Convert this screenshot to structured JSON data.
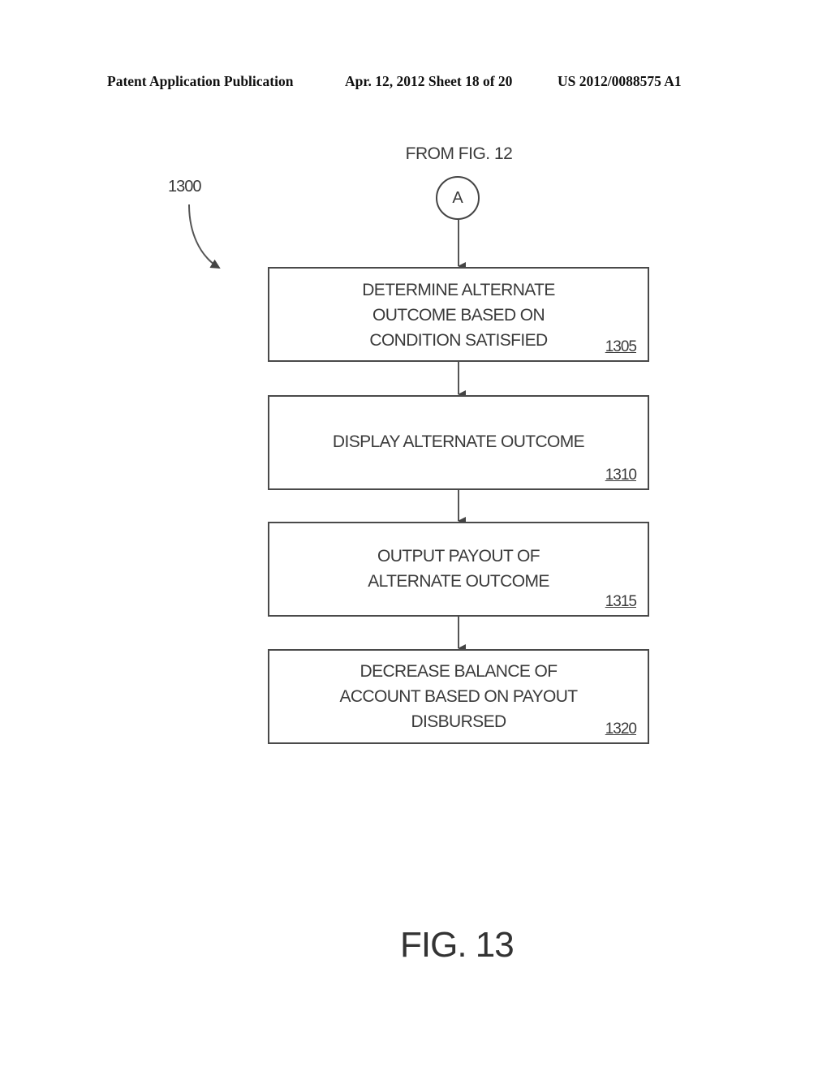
{
  "header": {
    "publication": "Patent Application Publication",
    "date_sheet": "Apr. 12, 2012  Sheet 18 of 20",
    "patent_number": "US 2012/0088575 A1"
  },
  "diagram": {
    "reference_number": "1300",
    "entry": {
      "label": "FROM FIG. 12",
      "connector": "A"
    },
    "steps": [
      {
        "id": "1305",
        "text": "DETERMINE ALTERNATE\nOUTCOME BASED ON\nCONDITION SATISFIED"
      },
      {
        "id": "1310",
        "text": "DISPLAY ALTERNATE OUTCOME"
      },
      {
        "id": "1315",
        "text": "OUTPUT PAYOUT OF\nALTERNATE OUTCOME"
      },
      {
        "id": "1320",
        "text": "DECREASE BALANCE OF\nACCOUNT BASED ON PAYOUT\nDISBURSED"
      }
    ],
    "figure_label": "FIG. 13"
  }
}
